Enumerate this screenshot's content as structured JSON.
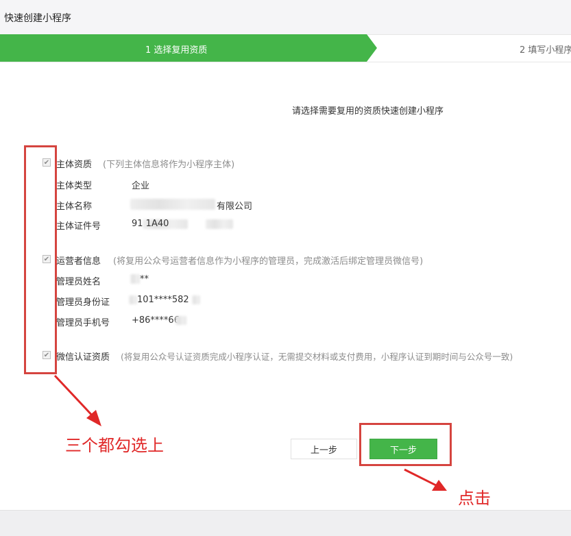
{
  "window": {
    "title": "快速创建小程序"
  },
  "steps": [
    {
      "label": "1 选择复用资质",
      "active": true
    },
    {
      "label": "2 填写小程序",
      "active": false
    }
  ],
  "intro": "请选择需要复用的资质快速创建小程序",
  "sections": {
    "subject": {
      "title": "主体资质",
      "hint": "(下列主体信息将作为小程序主体)",
      "checked": true,
      "fields": [
        {
          "key": "主体类型",
          "value": "企业"
        },
        {
          "key": "主体名称",
          "value": "有限公司"
        },
        {
          "key": "主体证件号",
          "value": "91 1A40"
        }
      ]
    },
    "operator": {
      "title": "运营者信息",
      "hint": "(将复用公众号运营者信息作为小程序的管理员，完成激活后绑定管理员微信号)",
      "checked": true,
      "fields": [
        {
          "key": "管理员姓名",
          "value": "**"
        },
        {
          "key": "管理员身份证",
          "value": "101****582"
        },
        {
          "key": "管理员手机号",
          "value": "+86****66"
        }
      ]
    },
    "wechat_cert": {
      "title": "微信认证资质",
      "hint": "(将复用公众号认证资质完成小程序认证，无需提交材料或支付费用，小程序认证到期时间与公众号一致)",
      "checked": true
    }
  },
  "buttons": {
    "prev": "上一步",
    "next": "下一步"
  },
  "annotations": {
    "check_all": "三个都勾选上",
    "click": "点击"
  },
  "colors": {
    "primary_green": "#44b549",
    "annotation_red": "#d5443f"
  },
  "icons": {
    "checkbox_mark": "✔"
  }
}
